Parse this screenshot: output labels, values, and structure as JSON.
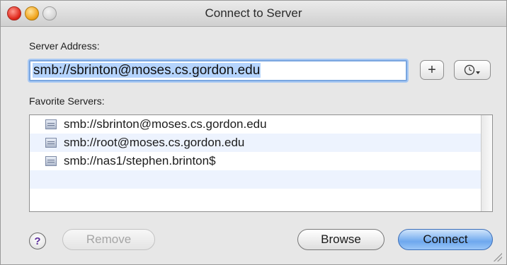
{
  "window": {
    "title": "Connect to Server"
  },
  "server_address": {
    "label": "Server Address:",
    "value": "smb://sbrinton@moses.cs.gordon.edu"
  },
  "buttons": {
    "add": "+",
    "recent_icon": "clock-dropdown-icon",
    "help": "?",
    "remove": "Remove",
    "browse": "Browse",
    "connect": "Connect"
  },
  "favorites": {
    "label": "Favorite Servers:",
    "items": [
      {
        "address": "smb://sbrinton@moses.cs.gordon.edu",
        "icon": "server-icon"
      },
      {
        "address": "smb://root@moses.cs.gordon.edu",
        "icon": "server-icon"
      },
      {
        "address": "smb://nas1/stephen.brinton$",
        "icon": "server-icon"
      }
    ]
  },
  "colors": {
    "accent": "#6ea8ee",
    "selection": "#b5d4fd"
  }
}
